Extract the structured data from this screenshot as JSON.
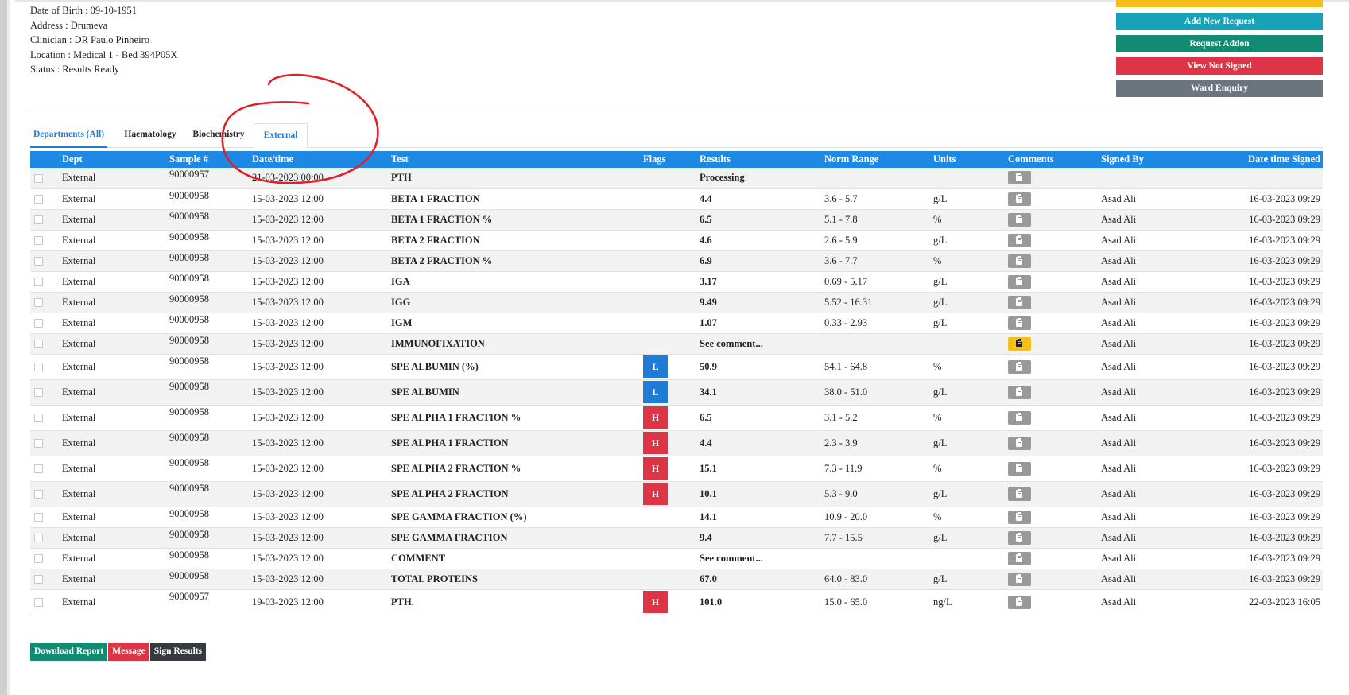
{
  "patient": {
    "dob": "Date of Birth : 09-10-1951",
    "address": "Address : Drumeva",
    "clinician": "Clinician : DR Paulo Pinheiro",
    "location": "Location : Medical 1 - Bed 394P05X",
    "status": "Status : Results Ready"
  },
  "actions": {
    "add_new_request": "Add New Request",
    "request_addon": "Request Addon",
    "view_not_signed": "View Not Signed",
    "ward_enquiry": "Ward Enquiry",
    "colors": {
      "top_partial": "#f5bf1b",
      "add_new_request": "#17a2b8",
      "request_addon": "#138a72",
      "view_not_signed": "#dc3545",
      "ward_enquiry": "#6c757d"
    }
  },
  "tabs": [
    "Departments (All)",
    "Haematology",
    "Biochemistry",
    "External"
  ],
  "table": {
    "headers": [
      "Dept",
      "Sample #",
      "Date/time",
      "Test",
      "Flags",
      "Results",
      "Norm Range",
      "Units",
      "Comments",
      "Signed By",
      "Date time Signed"
    ],
    "rows": [
      {
        "dept": "External",
        "sample": "90000957",
        "datetime": "21-03-2023 00:00",
        "test": "PTH",
        "flag": "",
        "result": "Processing",
        "range": "",
        "units": "",
        "comment_style": "gray",
        "signed_by": "",
        "signed_at": ""
      },
      {
        "dept": "External",
        "sample": "90000958",
        "datetime": "15-03-2023 12:00",
        "test": "BETA 1 FRACTION",
        "flag": "",
        "result": "4.4",
        "range": "3.6 - 5.7",
        "units": "g/L",
        "comment_style": "gray",
        "signed_by": "Asad Ali",
        "signed_at": "16-03-2023 09:29"
      },
      {
        "dept": "External",
        "sample": "90000958",
        "datetime": "15-03-2023 12:00",
        "test": "BETA 1 FRACTION %",
        "flag": "",
        "result": "6.5",
        "range": "5.1 - 7.8",
        "units": "%",
        "comment_style": "gray",
        "signed_by": "Asad Ali",
        "signed_at": "16-03-2023 09:29"
      },
      {
        "dept": "External",
        "sample": "90000958",
        "datetime": "15-03-2023 12:00",
        "test": "BETA 2 FRACTION",
        "flag": "",
        "result": "4.6",
        "range": "2.6 - 5.9",
        "units": "g/L",
        "comment_style": "gray",
        "signed_by": "Asad Ali",
        "signed_at": "16-03-2023 09:29"
      },
      {
        "dept": "External",
        "sample": "90000958",
        "datetime": "15-03-2023 12:00",
        "test": "BETA 2 FRACTION %",
        "flag": "",
        "result": "6.9",
        "range": "3.6 - 7.7",
        "units": "%",
        "comment_style": "gray",
        "signed_by": "Asad Ali",
        "signed_at": "16-03-2023 09:29"
      },
      {
        "dept": "External",
        "sample": "90000958",
        "datetime": "15-03-2023 12:00",
        "test": "IGA",
        "flag": "",
        "result": "3.17",
        "range": "0.69 - 5.17",
        "units": "g/L",
        "comment_style": "gray",
        "signed_by": "Asad Ali",
        "signed_at": "16-03-2023 09:29"
      },
      {
        "dept": "External",
        "sample": "90000958",
        "datetime": "15-03-2023 12:00",
        "test": "IGG",
        "flag": "",
        "result": "9.49",
        "range": "5.52 - 16.31",
        "units": "g/L",
        "comment_style": "gray",
        "signed_by": "Asad Ali",
        "signed_at": "16-03-2023 09:29"
      },
      {
        "dept": "External",
        "sample": "90000958",
        "datetime": "15-03-2023 12:00",
        "test": "IGM",
        "flag": "",
        "result": "1.07",
        "range": "0.33 - 2.93",
        "units": "g/L",
        "comment_style": "gray",
        "signed_by": "Asad Ali",
        "signed_at": "16-03-2023 09:29"
      },
      {
        "dept": "External",
        "sample": "90000958",
        "datetime": "15-03-2023 12:00",
        "test": "IMMUNOFIXATION",
        "flag": "",
        "result": "See comment...",
        "range": "",
        "units": "",
        "comment_style": "warning",
        "signed_by": "Asad Ali",
        "signed_at": "16-03-2023 09:29"
      },
      {
        "dept": "External",
        "sample": "90000958",
        "datetime": "15-03-2023 12:00",
        "test": "SPE ALBUMIN (%)",
        "flag": "L",
        "result": "50.9",
        "range": "54.1 - 64.8",
        "units": "%",
        "comment_style": "gray",
        "signed_by": "Asad Ali",
        "signed_at": "16-03-2023 09:29"
      },
      {
        "dept": "External",
        "sample": "90000958",
        "datetime": "15-03-2023 12:00",
        "test": "SPE ALBUMIN",
        "flag": "L",
        "result": "34.1",
        "range": "38.0 - 51.0",
        "units": "g/L",
        "comment_style": "gray",
        "signed_by": "Asad Ali",
        "signed_at": "16-03-2023 09:29"
      },
      {
        "dept": "External",
        "sample": "90000958",
        "datetime": "15-03-2023 12:00",
        "test": "SPE ALPHA 1 FRACTION %",
        "flag": "H",
        "result": "6.5",
        "range": "3.1 - 5.2",
        "units": "%",
        "comment_style": "gray",
        "signed_by": "Asad Ali",
        "signed_at": "16-03-2023 09:29"
      },
      {
        "dept": "External",
        "sample": "90000958",
        "datetime": "15-03-2023 12:00",
        "test": "SPE ALPHA 1 FRACTION",
        "flag": "H",
        "result": "4.4",
        "range": "2.3 - 3.9",
        "units": "g/L",
        "comment_style": "gray",
        "signed_by": "Asad Ali",
        "signed_at": "16-03-2023 09:29"
      },
      {
        "dept": "External",
        "sample": "90000958",
        "datetime": "15-03-2023 12:00",
        "test": "SPE ALPHA 2 FRACTION %",
        "flag": "H",
        "result": "15.1",
        "range": "7.3 - 11.9",
        "units": "%",
        "comment_style": "gray",
        "signed_by": "Asad Ali",
        "signed_at": "16-03-2023 09:29"
      },
      {
        "dept": "External",
        "sample": "90000958",
        "datetime": "15-03-2023 12:00",
        "test": "SPE ALPHA 2 FRACTION",
        "flag": "H",
        "result": "10.1",
        "range": "5.3 - 9.0",
        "units": "g/L",
        "comment_style": "gray",
        "signed_by": "Asad Ali",
        "signed_at": "16-03-2023 09:29"
      },
      {
        "dept": "External",
        "sample": "90000958",
        "datetime": "15-03-2023 12:00",
        "test": "SPE GAMMA FRACTION (%)",
        "flag": "",
        "result": "14.1",
        "range": "10.9 - 20.0",
        "units": "%",
        "comment_style": "gray",
        "signed_by": "Asad Ali",
        "signed_at": "16-03-2023 09:29"
      },
      {
        "dept": "External",
        "sample": "90000958",
        "datetime": "15-03-2023 12:00",
        "test": "SPE GAMMA FRACTION",
        "flag": "",
        "result": "9.4",
        "range": "7.7 - 15.5",
        "units": "g/L",
        "comment_style": "gray",
        "signed_by": "Asad Ali",
        "signed_at": "16-03-2023 09:29"
      },
      {
        "dept": "External",
        "sample": "90000958",
        "datetime": "15-03-2023 12:00",
        "test": "COMMENT",
        "flag": "",
        "result": "See comment...",
        "range": "",
        "units": "",
        "comment_style": "gray",
        "signed_by": "Asad Ali",
        "signed_at": "16-03-2023 09:29"
      },
      {
        "dept": "External",
        "sample": "90000958",
        "datetime": "15-03-2023 12:00",
        "test": "TOTAL PROTEINS",
        "flag": "",
        "result": "67.0",
        "range": "64.0 - 83.0",
        "units": "g/L",
        "comment_style": "gray",
        "signed_by": "Asad Ali",
        "signed_at": "16-03-2023 09:29"
      },
      {
        "dept": "External",
        "sample": "90000957",
        "datetime": "19-03-2023 12:00",
        "test": "PTH.",
        "flag": "H",
        "result": "101.0",
        "range": "15.0 - 65.0",
        "units": "ng/L",
        "comment_style": "gray",
        "signed_by": "Asad Ali",
        "signed_at": "22-03-2023 16:05"
      }
    ]
  },
  "bottom_actions": {
    "download_report": "Download Report",
    "message": "Message",
    "sign_results": "Sign Results"
  },
  "colors": {
    "header_blue": "#1e88e5",
    "flag_low": "#1e7bd6",
    "flag_high": "#dc3545",
    "annotation_red": "#e0202a"
  }
}
